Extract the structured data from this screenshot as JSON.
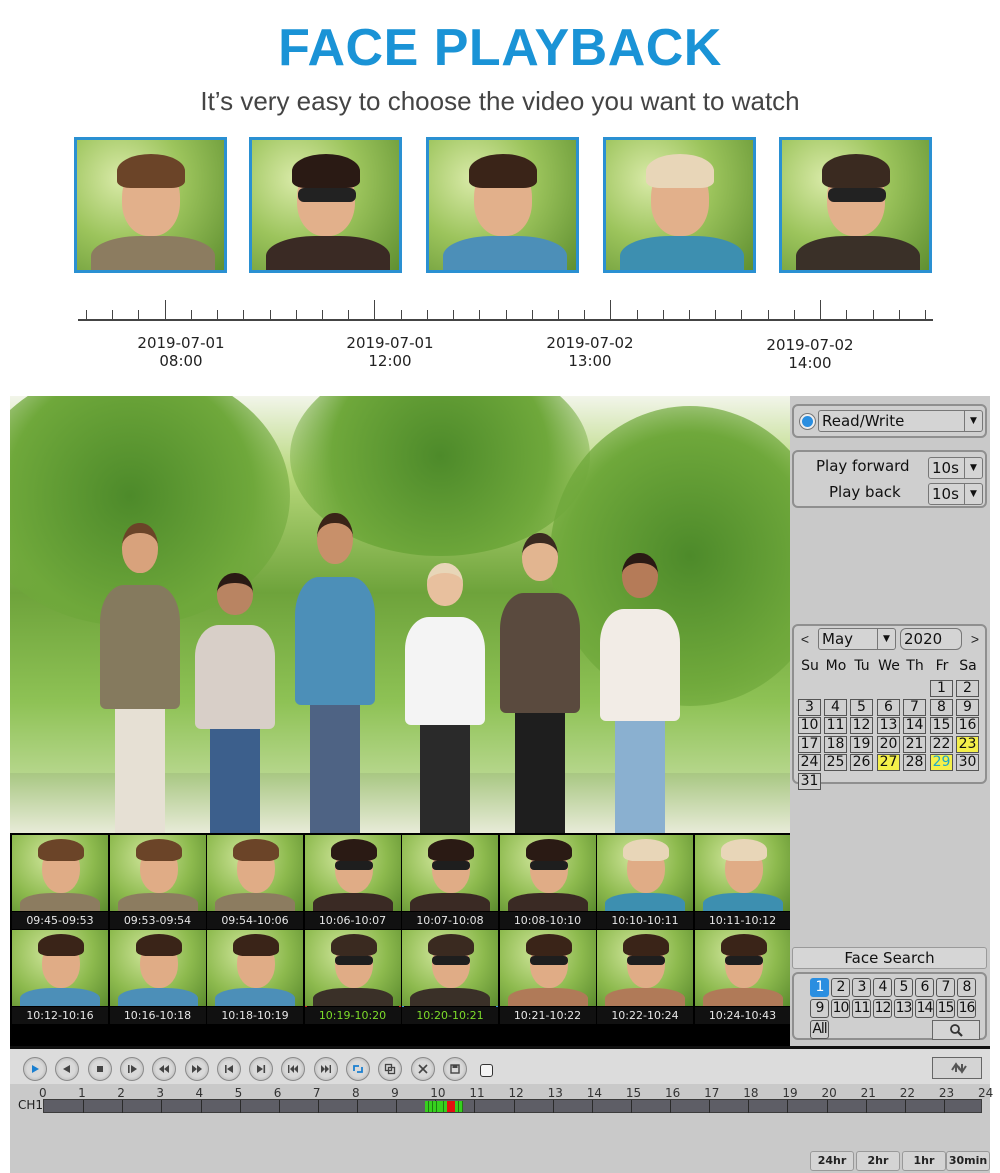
{
  "hero": {
    "title": "FACE PLAYBACK",
    "subtitle": "It’s very easy to choose the video you want to watch"
  },
  "faces": [
    {
      "name": "bearded-man",
      "hair": "#6b4428",
      "body": "#8c7c60",
      "glasses": false
    },
    {
      "name": "woman-sunglasses-curly",
      "hair": "#2a1a14",
      "body": "#3a2a24",
      "glasses": true
    },
    {
      "name": "curly-hair-man",
      "hair": "#3a2418",
      "body": "#4c8fb8",
      "glasses": false
    },
    {
      "name": "blonde-woman",
      "hair": "#e8d6b8",
      "body": "#3d8fb0",
      "glasses": false
    },
    {
      "name": "short-hair-sunglasses",
      "hair": "#3a2a20",
      "body": "#3a3028",
      "glasses": true
    }
  ],
  "timeline": {
    "labels": [
      {
        "date": "2019-07-01",
        "time": "08:00"
      },
      {
        "date": "2019-07-01",
        "time": "12:00"
      },
      {
        "date": "2019-07-02",
        "time": "13:00"
      },
      {
        "date": "2019-07-02",
        "time": "14:00"
      }
    ]
  },
  "side_panel": {
    "mode_select": "Read/Write",
    "play_forward_label": "Play forward",
    "play_forward_value": "10s",
    "play_back_label": "Play back",
    "play_back_value": "10s",
    "calendar": {
      "prev": "<",
      "next": ">",
      "month": "May",
      "year": "2020",
      "weekdays": [
        "Su",
        "Mo",
        "Tu",
        "We",
        "Th",
        "Fr",
        "Sa"
      ],
      "first_weekday_index": 5,
      "days_in_month": 31,
      "marked_days": [
        23,
        27,
        29
      ],
      "highlight_day": 29
    },
    "face_search_label": "Face Search",
    "channels": [
      "1",
      "2",
      "3",
      "4",
      "5",
      "6",
      "7",
      "8",
      "9",
      "10",
      "11",
      "12",
      "13",
      "14",
      "15",
      "16"
    ],
    "active_channel": "1",
    "all_label": "All",
    "search_icon": "magnifier-icon"
  },
  "thumbnails": [
    {
      "time": "09:45-09:53",
      "face": 0,
      "state": "normal"
    },
    {
      "time": "09:53-09:54",
      "face": 0,
      "state": "normal"
    },
    {
      "time": "09:54-10:06",
      "face": 0,
      "state": "normal"
    },
    {
      "time": "10:06-10:07",
      "face": 1,
      "state": "normal"
    },
    {
      "time": "10:07-10:08",
      "face": 1,
      "state": "normal"
    },
    {
      "time": "10:08-10:10",
      "face": 1,
      "state": "normal"
    },
    {
      "time": "10:10-10:11",
      "face": 3,
      "state": "normal"
    },
    {
      "time": "10:11-10:12",
      "face": 3,
      "state": "normal"
    },
    {
      "time": "10:12-10:16",
      "face": 2,
      "state": "normal"
    },
    {
      "time": "10:16-10:18",
      "face": 2,
      "state": "normal"
    },
    {
      "time": "10:18-10:19",
      "face": 2,
      "state": "normal"
    },
    {
      "time": "10:19-10:20",
      "face": 4,
      "state": "selected-red"
    },
    {
      "time": "10:20-10:21",
      "face": 4,
      "state": "selected-blue"
    },
    {
      "time": "10:21-10:22",
      "face": 5,
      "state": "normal"
    },
    {
      "time": "10:22-10:24",
      "face": 5,
      "state": "normal"
    },
    {
      "time": "10:24-10:43",
      "face": 5,
      "state": "normal"
    }
  ],
  "toolbar": {
    "buttons": [
      "play",
      "reverse-play",
      "stop",
      "step-forward",
      "fast-rewind",
      "fast-forward",
      "previous-frame",
      "next-frame",
      "previous-file",
      "next-file",
      "sync",
      "multi-screen",
      "clip",
      "save"
    ],
    "sync_icon": "swap-arrows-icon"
  },
  "track": {
    "channel_label": "CH1",
    "hours": [
      "0",
      "1",
      "2",
      "3",
      "4",
      "5",
      "6",
      "7",
      "8",
      "9",
      "10",
      "11",
      "12",
      "13",
      "14",
      "15",
      "16",
      "17",
      "18",
      "19",
      "20",
      "21",
      "22",
      "23",
      "24"
    ],
    "record_segments": [
      {
        "start": 9.75,
        "end": 10.13,
        "type": "face",
        "color": "#36d01e"
      },
      {
        "start": 10.13,
        "end": 10.31,
        "type": "face",
        "color": "#36d01e"
      },
      {
        "start": 10.31,
        "end": 10.5,
        "type": "alarm",
        "color": "#e21010"
      },
      {
        "start": 10.5,
        "end": 10.72,
        "type": "face",
        "color": "#36d01e"
      }
    ],
    "zoom_buttons": [
      "24hr",
      "2hr",
      "1hr",
      "30min"
    ]
  },
  "colors": {
    "brand_blue": "#1a93d6",
    "highlight_yellow": "#f4f04a",
    "record_green": "#36d01e",
    "record_red": "#e21010"
  }
}
